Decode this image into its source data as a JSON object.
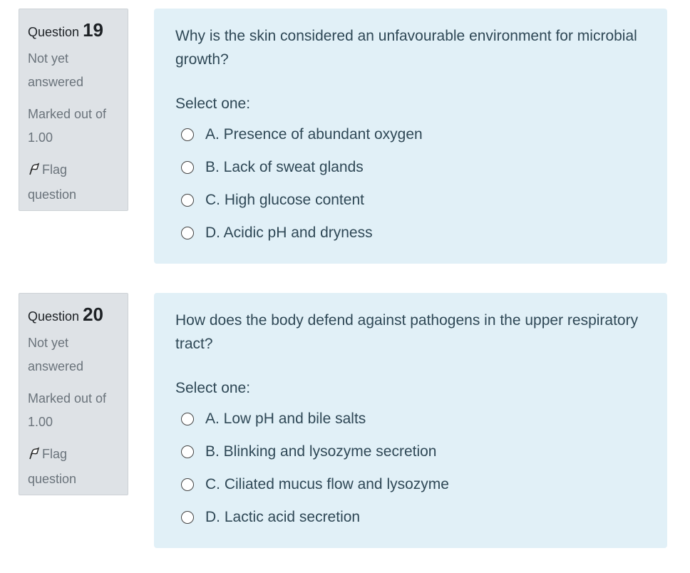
{
  "questions": [
    {
      "label": "Question",
      "number": "19",
      "state": "Not yet answered",
      "grade": "Marked out of 1.00",
      "flag": "Flag question",
      "text": "Why is the skin considered an unfavourable environment for microbial growth?",
      "prompt": "Select one:",
      "options": [
        "A. Presence of abundant oxygen",
        "B. Lack of sweat glands",
        "C. High glucose content",
        "D. Acidic pH and dryness"
      ]
    },
    {
      "label": "Question",
      "number": "20",
      "state": "Not yet answered",
      "grade": "Marked out of 1.00",
      "flag": "Flag question",
      "text": "How does the body defend against pathogens in the upper respiratory tract?",
      "prompt": "Select one:",
      "options": [
        "A. Low pH and bile salts",
        "B. Blinking and lysozyme secretion",
        "C. Ciliated mucus flow and lysozyme",
        "D. Lactic acid secretion"
      ]
    }
  ]
}
